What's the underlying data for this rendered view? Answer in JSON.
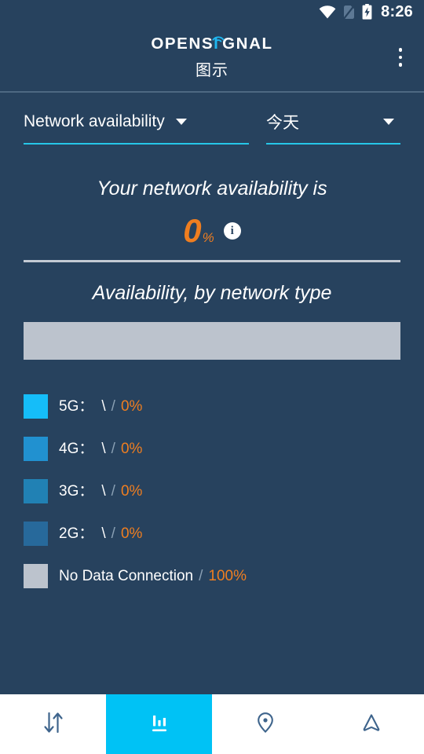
{
  "status_bar": {
    "time": "8:26",
    "icons": [
      "wifi-icon",
      "no-sim-icon",
      "battery-charging-icon"
    ]
  },
  "header": {
    "brand_prefix": "OPENS",
    "brand_i": "I",
    "brand_suffix": "GNAL",
    "subtitle": "图示",
    "overflow_label": "more-options"
  },
  "filters": {
    "metric": {
      "label": "Network availability",
      "caret": "chevron-down-icon"
    },
    "period": {
      "label": "今天",
      "caret": "chevron-down-icon"
    }
  },
  "summary": {
    "headline": "Your network availability is",
    "value": "0",
    "unit": "%",
    "info_glyph": "i",
    "info_icon": "info-icon"
  },
  "chart_section": {
    "title": "Availability, by network type"
  },
  "chart_data": {
    "type": "bar",
    "orientation": "horizontal-stacked",
    "title": "Availability, by network type",
    "xlabel": "",
    "ylabel": "",
    "categories": [
      "5G",
      "4G",
      "3G",
      "2G",
      "No Data Connection"
    ],
    "values": [
      0,
      0,
      0,
      0,
      100
    ],
    "value_labels": [
      "0%",
      "0%",
      "0%",
      "0%",
      "100%"
    ],
    "colors": [
      "#15bdf9",
      "#2191d0",
      "#2181b4",
      "#27699b",
      "#bcc3cd"
    ],
    "unit": "%",
    "total": 100,
    "legend": "below",
    "grid": false
  },
  "legend": {
    "separator": "/",
    "rows": [
      {
        "name": "5G",
        "colon": "：",
        "speed": "\\",
        "sep": "/",
        "percent": "0%",
        "color": "#15bdf9"
      },
      {
        "name": "4G",
        "colon": "：",
        "speed": "\\",
        "sep": "/",
        "percent": "0%",
        "color": "#2191d0"
      },
      {
        "name": "3G",
        "colon": "：",
        "speed": "\\",
        "sep": "/",
        "percent": "0%",
        "color": "#2181b4"
      },
      {
        "name": "2G",
        "colon": "：",
        "speed": "\\",
        "sep": "/",
        "percent": "0%",
        "color": "#27699b"
      },
      {
        "name": "No Data Connection",
        "colon": "",
        "speed": "",
        "sep": "/",
        "percent": "100%",
        "color": "#bcc3cd"
      }
    ]
  },
  "bottom_nav": {
    "items": [
      {
        "icon": "speed-test-icon",
        "active": false
      },
      {
        "icon": "bar-chart-icon",
        "active": true
      },
      {
        "icon": "location-pin-icon",
        "active": false
      },
      {
        "icon": "navigation-arrow-icon",
        "active": false
      }
    ]
  },
  "colors": {
    "background": "#27425e",
    "accent_cyan": "#00c2f5",
    "accent_orange": "#ef7e20",
    "underline": "#26c6e8",
    "nav_icon": "#3e648c"
  }
}
